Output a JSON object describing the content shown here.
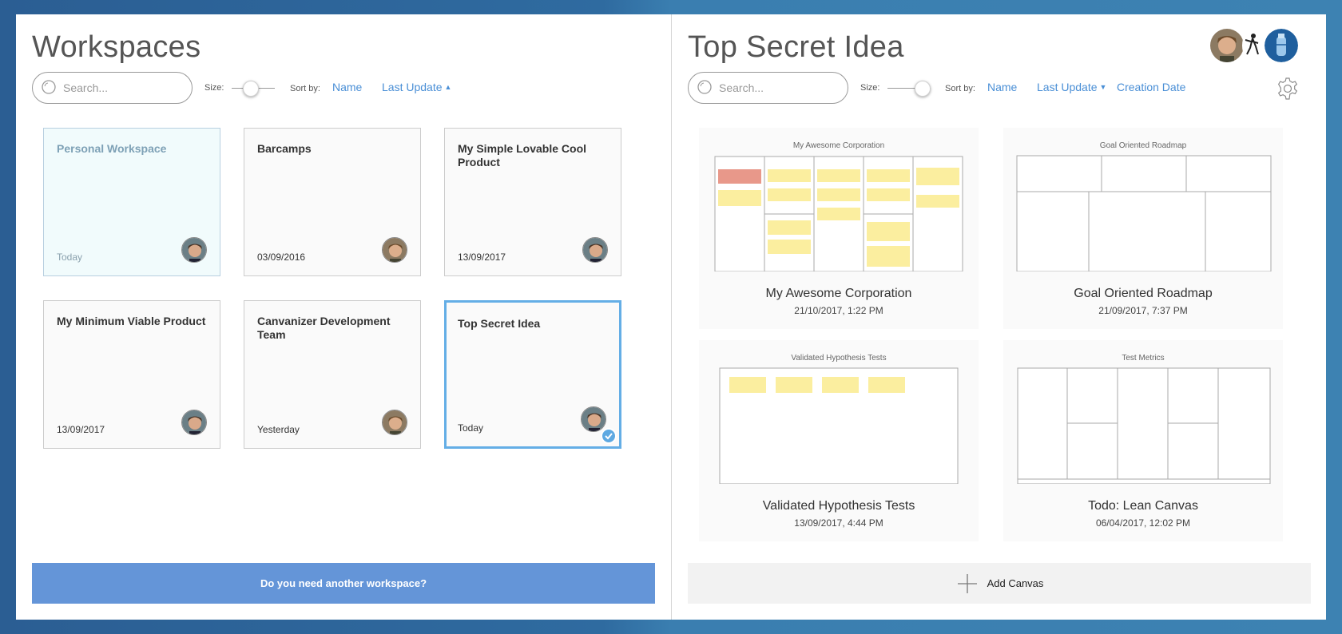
{
  "left": {
    "title": "Workspaces",
    "search_placeholder": "Search...",
    "size_label": "Size:",
    "sort_label": "Sort by:",
    "sort_name": "Name",
    "sort_last_update": "Last Update",
    "size_level": 0.45,
    "workspaces": [
      {
        "name": "Personal Workspace",
        "date": "Today"
      },
      {
        "name": "Barcamps",
        "date": "03/09/2016"
      },
      {
        "name": "My Simple Lovable Cool Product",
        "date": "13/09/2017"
      },
      {
        "name": "My Minimum Viable Product",
        "date": "13/09/2017"
      },
      {
        "name": "Canvanizer Development Team",
        "date": "Yesterday"
      },
      {
        "name": "Top Secret Idea",
        "date": "Today"
      }
    ],
    "cta_label": "Do you need another workspace?"
  },
  "right": {
    "title": "Top Secret Idea",
    "search_placeholder": "Search...",
    "size_label": "Size:",
    "sort_label": "Sort by:",
    "sort_name": "Name",
    "sort_last_update": "Last Update",
    "sort_creation_date": "Creation Date",
    "size_level": 0.8,
    "canvases": [
      {
        "name": "My Awesome Corporation",
        "date": "21/10/2017, 1:22 PM",
        "thumb_title": "My Awesome Corporation"
      },
      {
        "name": "Goal Oriented Roadmap",
        "date": "21/09/2017, 7:37 PM",
        "thumb_title": "Goal Oriented Roadmap"
      },
      {
        "name": "Validated Hypothesis Tests",
        "date": "13/09/2017, 4:44 PM",
        "thumb_title": "Validated Hypothesis Tests"
      },
      {
        "name": "Todo: Lean Canvas",
        "date": "06/04/2017, 12:02 PM",
        "thumb_title": "Test Metrics"
      }
    ],
    "add_canvas_label": "Add Canvas"
  },
  "colors": {
    "accent": "#4a8fd6",
    "cta": "#6495d8",
    "selected_border": "#64aee6",
    "sticky": "#fbee9f",
    "sticky_red": "#e8988a"
  }
}
